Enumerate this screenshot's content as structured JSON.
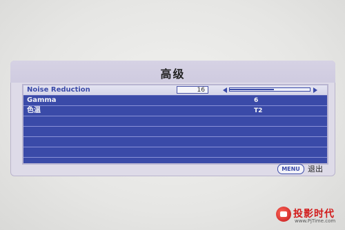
{
  "osd": {
    "title": "高级",
    "rows": [
      {
        "label": "Noise Reduction",
        "value": "16",
        "slider_fraction": 0.55
      },
      {
        "label": "Gamma",
        "value": "6"
      },
      {
        "label": "色温",
        "value": "T2"
      },
      {
        "label": "",
        "value": ""
      },
      {
        "label": "",
        "value": ""
      },
      {
        "label": "",
        "value": ""
      },
      {
        "label": "",
        "value": ""
      }
    ]
  },
  "footer": {
    "menu_label": "MENU",
    "exit_label": "退出"
  },
  "watermark": {
    "name": "投影时代",
    "url": "www.PjTime.com"
  },
  "colors": {
    "panel": "#3a4aa8",
    "frame": "#dedbe8",
    "selected_row": "#d4d4e8",
    "watermark_red": "#d21a1a"
  }
}
